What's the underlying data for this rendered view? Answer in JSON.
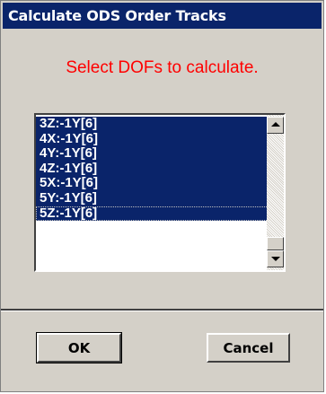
{
  "window": {
    "title": "Calculate ODS Order Tracks"
  },
  "prompt": "Select DOFs to calculate.",
  "dof_list": {
    "items": [
      "3Z:-1Y[6]",
      "4X:-1Y[6]",
      "4Y:-1Y[6]",
      "4Z:-1Y[6]",
      "5X:-1Y[6]",
      "5Y:-1Y[6]",
      "5Z:-1Y[6]"
    ],
    "selected": "all visible",
    "focused_item": "5Z:-1Y[6]"
  },
  "buttons": {
    "ok": "OK",
    "cancel": "Cancel"
  },
  "colors": {
    "title_bar": "#0a246a",
    "prompt_text": "#ff0000",
    "selection": "#0a246a",
    "dialog_bg": "#d4d0c8"
  },
  "icons": {
    "scroll_up": "scroll-up-arrow-icon",
    "scroll_down": "scroll-down-arrow-icon"
  }
}
